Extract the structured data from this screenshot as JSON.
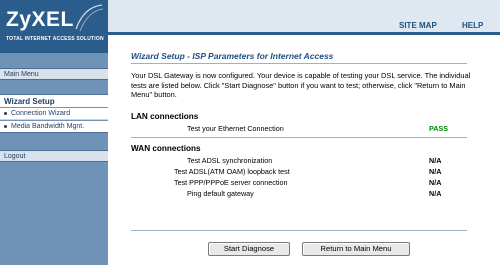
{
  "brand": {
    "logo": "ZyXEL",
    "tagline": "TOTAL INTERNET ACCESS SOLUTION"
  },
  "header": {
    "site_map": "SITE MAP",
    "help": "HELP"
  },
  "sidebar": {
    "main_menu": "Main Menu",
    "section_title": "Wizard Setup",
    "items": [
      {
        "label": "Connection Wizard"
      },
      {
        "label": "Media Bandwidth Mgnt."
      }
    ],
    "logout": "Logout"
  },
  "content": {
    "title": "Wizard Setup - ISP Parameters for Internet Access",
    "intro": "Your DSL Gateway is now configured. Your device is capable of testing your DSL service. The individual tests are listed below. Click \"Start Diagnose\" button if you want to test; otherwise, click \"Return to Main Menu\" button.",
    "lan": {
      "heading": "LAN connections",
      "tests": [
        {
          "label": "Test your Ethernet Connection",
          "result": "PASS"
        }
      ]
    },
    "wan": {
      "heading": "WAN connections",
      "tests": [
        {
          "label": "Test ADSL synchronization",
          "result": "N/A"
        },
        {
          "label": "Test ADSL(ATM OAM) loopback test",
          "result": "N/A"
        },
        {
          "label": "Test PPP/PPPoE server connection",
          "result": "N/A"
        },
        {
          "label": "Ping default gateway",
          "result": "N/A"
        }
      ]
    },
    "buttons": {
      "start_diagnose": "Start Diagnose",
      "return_main": "Return to Main Menu"
    }
  },
  "colors": {
    "sidebar": "#6f93b6",
    "logo_block": "#2b5d8c",
    "title": "#1f4f80",
    "pass": "#008a00"
  }
}
